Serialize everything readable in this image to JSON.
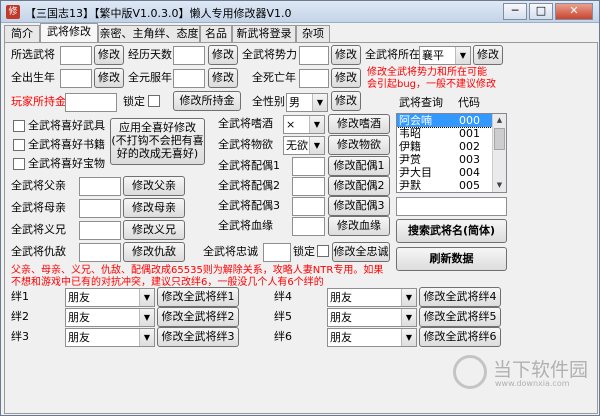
{
  "window": {
    "title": "【三国志13】【繁中版V1.0.3.0】懒人专用修改器V1.0",
    "icon_glyph": "修",
    "minimize": "─",
    "maximize": "□",
    "close": "✕"
  },
  "tabs": [
    "简介",
    "武将修改",
    "亲密、主角绊、态度",
    "名品",
    "新武将登录",
    "杂项"
  ],
  "active_tab": "武将修改",
  "fields": {
    "selected_general": {
      "label": "所选武将",
      "value": "",
      "btn": "修改"
    },
    "experience_days": {
      "label": "经历天数",
      "value": "",
      "btn": "修改"
    },
    "all_force": {
      "label": "全武将势力",
      "value": "",
      "btn": "修改"
    },
    "all_location": {
      "label": "全武将所在",
      "value": "襄平",
      "btn": "修改"
    },
    "birth_year": {
      "label": "全出生年",
      "value": "",
      "btn": "修改"
    },
    "coming_of_age": {
      "label": "全元服年",
      "value": "",
      "btn": "修改"
    },
    "death_year": {
      "label": "全死亡年",
      "value": "",
      "btn": "修改"
    },
    "player_money": {
      "label": "玩家所持金",
      "lock": "锁定",
      "btn": "修改所持金"
    },
    "all_gender": {
      "label": "全性别",
      "value": "男",
      "btn": "修改"
    },
    "hobby_weapon": {
      "label": "全武将喜好武具"
    },
    "hobby_book": {
      "label": "全武将喜好书籍"
    },
    "hobby_treasure": {
      "label": "全武将喜好宝物"
    },
    "apply_all_hobby": {
      "btn": "应用全喜好修改 (不打钩不会把有喜好的改成无喜好)"
    },
    "addiction": {
      "label": "全武将嗜酒",
      "value": "×",
      "btn": "修改嗜酒"
    },
    "desire": {
      "label": "全武将物欲",
      "value": "无欲",
      "btn": "修改物欲"
    },
    "spouse1": {
      "label": "全武将配偶1",
      "value": "",
      "btn": "修改配偶1"
    },
    "spouse2": {
      "label": "全武将配偶2",
      "value": "",
      "btn": "修改配偶2"
    },
    "spouse3": {
      "label": "全武将配偶3",
      "value": "",
      "btn": "修改配偶3"
    },
    "bloodline": {
      "label": "全武将血缘",
      "value": "",
      "btn": "修改血缘"
    },
    "father": {
      "label": "全武将父亲",
      "value": "",
      "btn": "修改父亲"
    },
    "mother": {
      "label": "全武将母亲",
      "value": "",
      "btn": "修改母亲"
    },
    "sworn": {
      "label": "全武将义兄",
      "value": "",
      "btn": "修改义兄"
    },
    "enemy": {
      "label": "全武将仇敌",
      "value": "",
      "btn": "修改仇敌"
    },
    "loyalty": {
      "label": "全武将忠诚",
      "value": "",
      "lock": "锁定",
      "btn": "修改全忠诚"
    }
  },
  "notes": {
    "force_note_1": "修改全武将势力和所在可能",
    "force_note_2": "会引起bug，一般不建议修改",
    "relation_note_1": "父亲、母亲、义兄、仇敌、配偶改成65535则为解除关系，攻略人妻NTR专用。如果",
    "relation_note_2": "不想和游戏中已有的对抗冲突，建议只改绊6，一般没几个人有6个绊的"
  },
  "lookup": {
    "header_name": "武将查询",
    "header_code": "代码",
    "rows": [
      {
        "name": "阿会喃",
        "code": "000"
      },
      {
        "name": "韦昭",
        "code": "001"
      },
      {
        "name": "伊籍",
        "code": "002"
      },
      {
        "name": "尹赏",
        "code": "003"
      },
      {
        "name": "尹大目",
        "code": "004"
      },
      {
        "name": "尹默",
        "code": "005"
      }
    ],
    "search_btn": "搜索武将名(简体)",
    "refresh_btn": "刷新数据"
  },
  "bonds": [
    {
      "label": "绊1",
      "value": "朋友",
      "btn": "修改全武将绊1"
    },
    {
      "label": "绊2",
      "value": "朋友",
      "btn": "修改全武将绊2"
    },
    {
      "label": "绊3",
      "value": "朋友",
      "btn": "修改全武将绊3"
    },
    {
      "label": "绊4",
      "value": "朋友",
      "btn": "修改全武将绊4"
    },
    {
      "label": "绊5",
      "value": "朋友",
      "btn": "修改全武将绊5"
    },
    {
      "label": "绊6",
      "value": "朋友",
      "btn": "修改全武将绊6"
    }
  ],
  "watermark": {
    "text": "当下软件园",
    "sub": "www.downxia.com"
  }
}
